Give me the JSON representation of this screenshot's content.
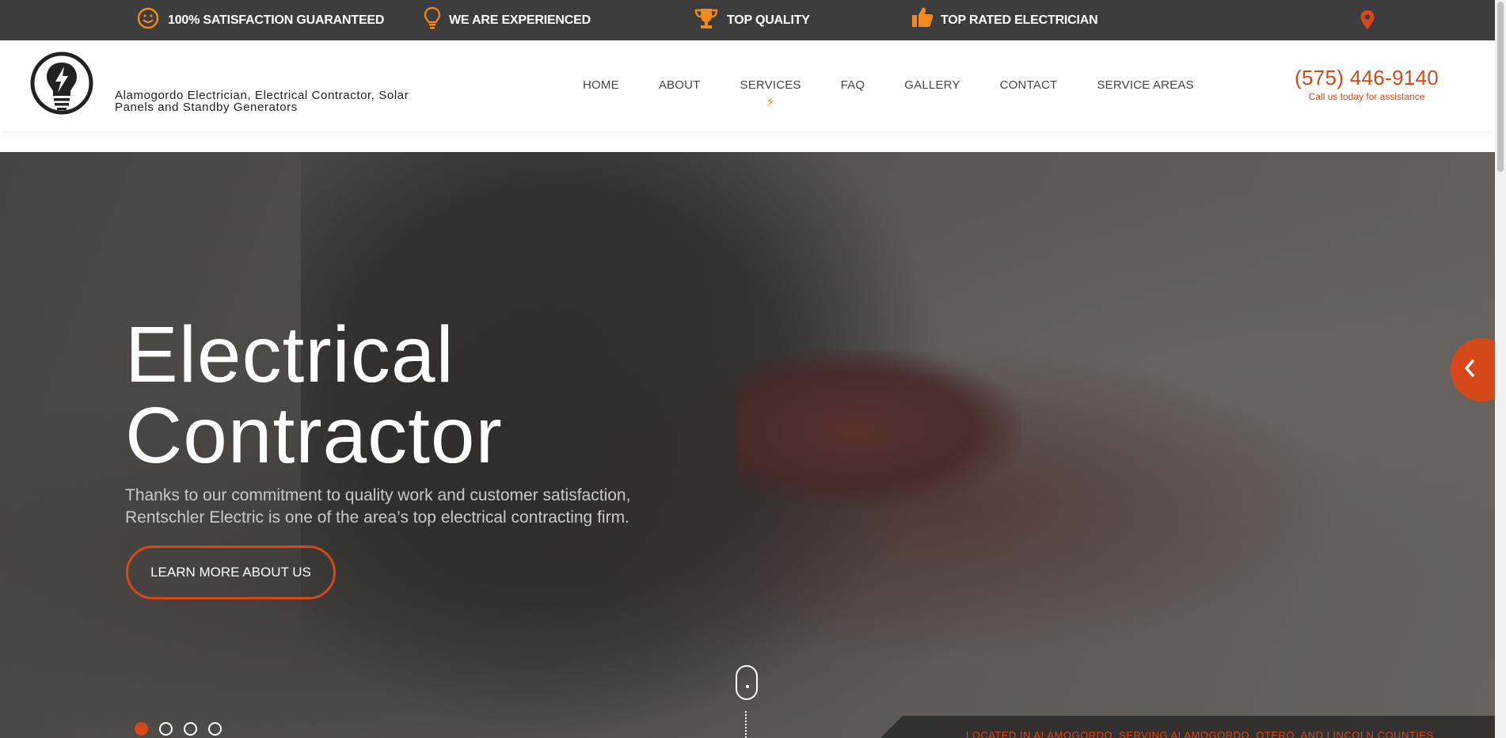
{
  "topbar": {
    "items": [
      {
        "label": "100% SATISFACTION GUARANTEED",
        "icon": "smiley-icon"
      },
      {
        "label": "WE ARE EXPERIENCED",
        "icon": "lightbulb-icon"
      },
      {
        "label": "TOP QUALITY",
        "icon": "trophy-icon"
      },
      {
        "label": "TOP RATED ELECTRICIAN",
        "icon": "thumbs-up-icon"
      }
    ],
    "location_icon": "map-pin-icon"
  },
  "header": {
    "tagline": "Alamogordo Electrician, Electrical Contractor, Solar Panels and Standby Generators",
    "logo_icon": "lightbulb-bolt-logo",
    "nav": [
      "HOME",
      "ABOUT",
      "SERVICES",
      "FAQ",
      "GALLERY",
      "CONTACT",
      "SERVICE AREAS"
    ],
    "services_indicator": "⚡",
    "phone": "(575) 446-9140",
    "phone_sub": "Call us today for assistance"
  },
  "hero": {
    "title_line1": "Electrical",
    "title_line2": "Contractor",
    "text_line1": "Thanks to our commitment to quality work and customer satisfaction,",
    "text_line2": "Rentschler Electric is one of the area’s top electrical contracting firm.",
    "button": "LEARN MORE ABOUT US",
    "slide_count": 4,
    "active_slide": 1,
    "ribbon_text": "LOCATED IN ALAMOGORDO, SERVING ALAMOGORDO, OTERO, AND LINCOLN COUNTIES"
  },
  "colors": {
    "accent": "#d5481a",
    "icon_orange": "#f08a1c",
    "topbar_bg": "#3d3d3d"
  }
}
